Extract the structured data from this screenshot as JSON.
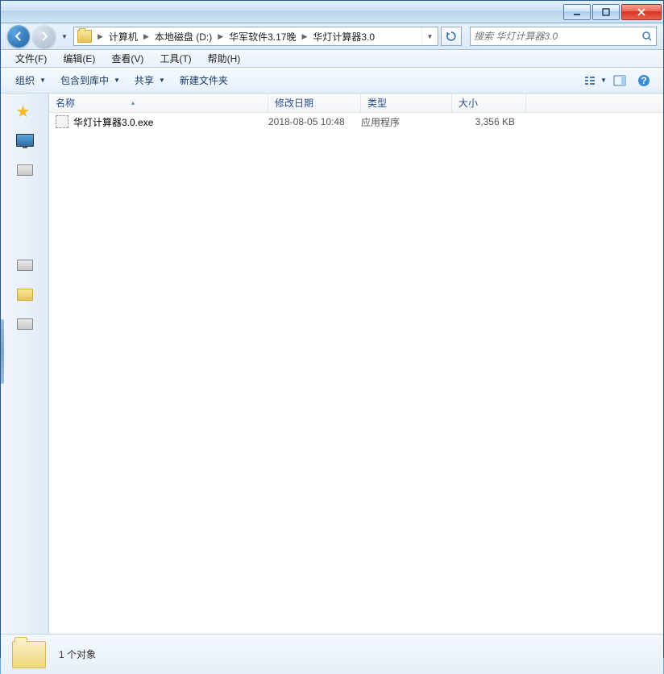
{
  "titlebar": {},
  "breadcrumb": {
    "items": [
      "计算机",
      "本地磁盘 (D:)",
      "华军软件3.17晚",
      "华灯计算器3.0"
    ]
  },
  "search": {
    "placeholder": "搜索 华灯计算器3.0"
  },
  "menu": {
    "file": "文件(F)",
    "edit": "编辑(E)",
    "view": "查看(V)",
    "tools": "工具(T)",
    "help": "帮助(H)"
  },
  "toolbar": {
    "organize": "组织",
    "include": "包含到库中",
    "share": "共享",
    "newfolder": "新建文件夹"
  },
  "columns": {
    "name": "名称",
    "modified": "修改日期",
    "type": "类型",
    "size": "大小"
  },
  "files": [
    {
      "name": "华灯计算器3.0.exe",
      "modified": "2018-08-05 10:48",
      "type": "应用程序",
      "size": "3,356 KB"
    }
  ],
  "status": {
    "text": "1 个对象"
  }
}
